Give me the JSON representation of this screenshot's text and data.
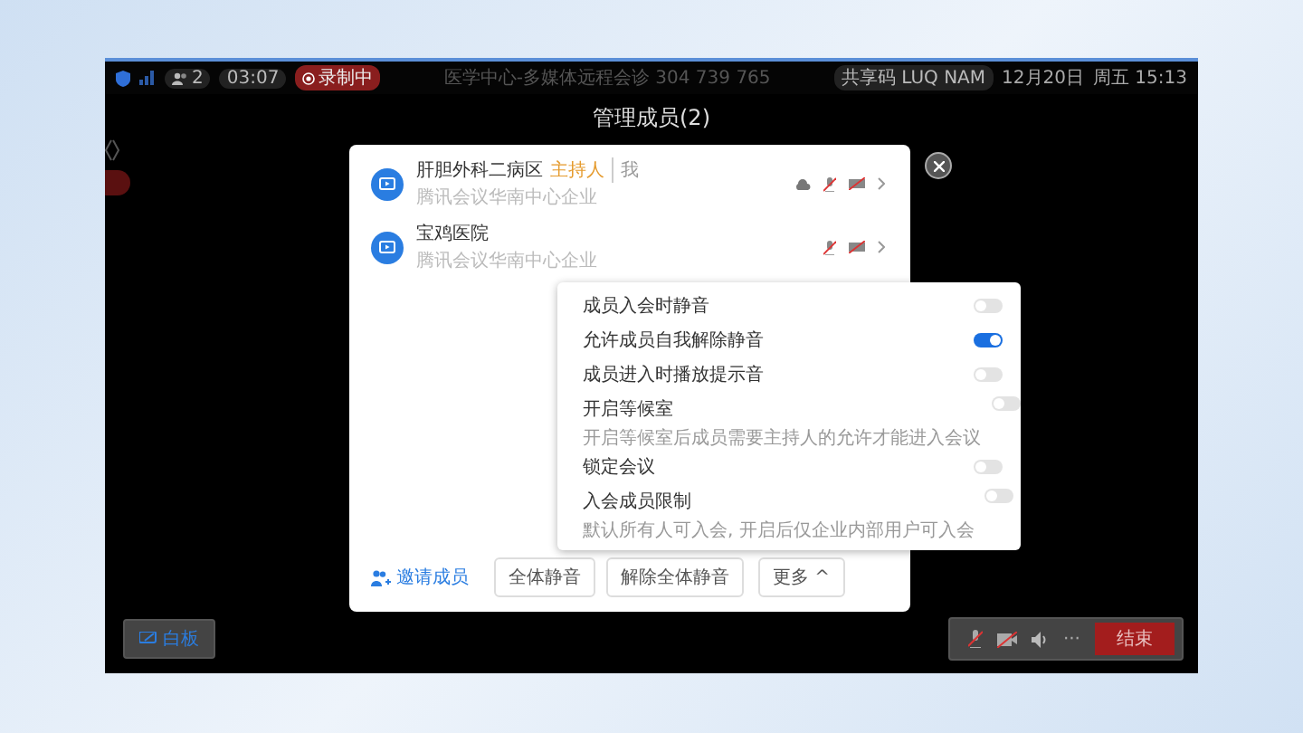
{
  "status_bar": {
    "participants": "2",
    "duration": "03:07",
    "recording": "录制中",
    "meeting_title": "医学中心-多媒体远程会诊 304 739 765",
    "share_code": "共享码 LUQ NAM",
    "date": "12月20日",
    "time": "周五 15:13"
  },
  "title": "管理成员(2)",
  "members": [
    {
      "name": "肝胆外科二病区",
      "role": "主持人",
      "self": "我",
      "subtitle": "腾讯会议华南中心企业",
      "audio_muted": true,
      "cloud": true
    },
    {
      "name": "宝鸡医院",
      "subtitle": "腾讯会议华南中心企业",
      "audio_muted": true,
      "cloud": false
    }
  ],
  "settings": [
    {
      "label": "成员入会时静音",
      "on": false
    },
    {
      "label": "允许成员自我解除静音",
      "on": true
    },
    {
      "label": "成员进入时播放提示音",
      "on": false
    },
    {
      "label": "开启等候室",
      "on": false,
      "description": "开启等候室后成员需要主持人的允许才能进入会议"
    },
    {
      "label": "锁定会议",
      "on": false
    },
    {
      "label": "入会成员限制",
      "on": false,
      "description": "默认所有人可入会, 开启后仅企业内部用户可入会"
    }
  ],
  "footer": {
    "invite": "邀请成员",
    "buttons": [
      "全体静音",
      "解除全体静音"
    ],
    "more": "更多 ^"
  },
  "bottom_bar": {
    "whiteboard": "白板",
    "more": "···",
    "end": "结束"
  }
}
